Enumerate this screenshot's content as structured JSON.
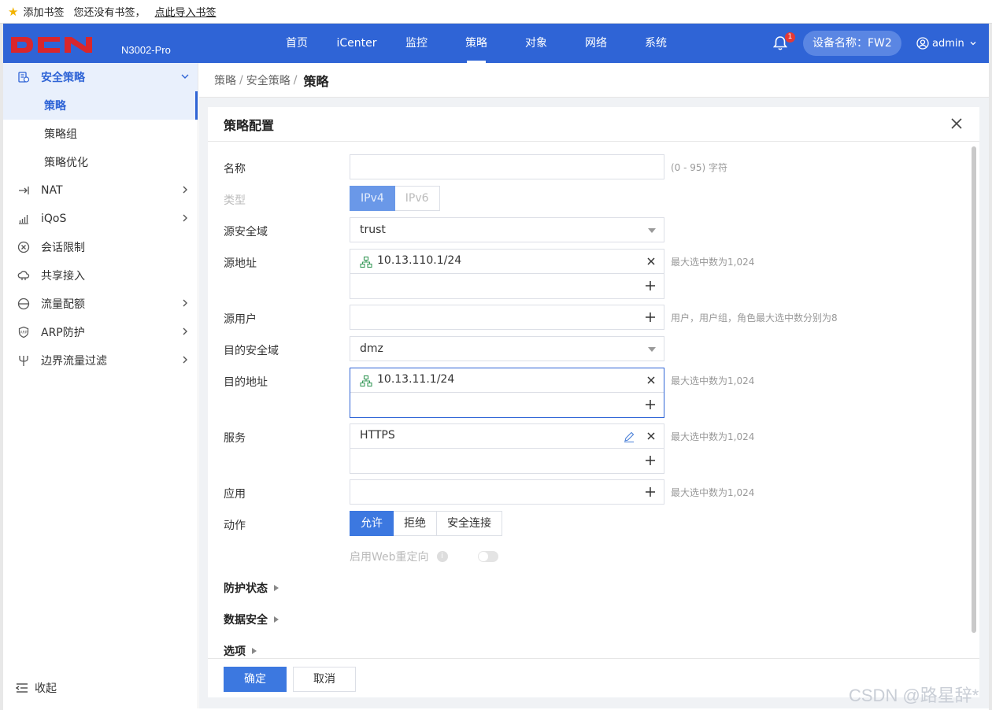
{
  "bookmarks_bar": {
    "add_bookmark": "添加书签",
    "no_bookmarks": "您还没有书签，",
    "import_link": "点此导入书签"
  },
  "header": {
    "model": "N3002-Pro",
    "nav": [
      "首页",
      "iCenter",
      "监控",
      "策略",
      "对象",
      "网络",
      "系统"
    ],
    "active_nav": "策略",
    "notification_count": "1",
    "device_name": "设备名称：FW2",
    "user": "admin",
    "brand_color": "#2f64d6"
  },
  "sidebar": {
    "group": {
      "label": "安全策略",
      "icon": "security-policy-icon"
    },
    "sub_items": [
      "策略",
      "策略组",
      "策略优化"
    ],
    "active_sub": "策略",
    "items": [
      {
        "label": "NAT",
        "icon": "nat-arrow-icon",
        "has_children": true
      },
      {
        "label": "iQoS",
        "icon": "bar-chart-icon",
        "has_children": true
      },
      {
        "label": "会话限制",
        "icon": "circle-x-icon",
        "has_children": false
      },
      {
        "label": "共享接入",
        "icon": "cloud-share-icon",
        "has_children": false
      },
      {
        "label": "流量配额",
        "icon": "quota-circle-icon",
        "has_children": true
      },
      {
        "label": "ARP防护",
        "icon": "arp-shield-icon",
        "has_children": true
      },
      {
        "label": "边界流量过滤",
        "icon": "trident-icon",
        "has_children": true
      }
    ],
    "collapse_label": "收起"
  },
  "breadcrumb": {
    "items": [
      "策略",
      "安全策略"
    ],
    "current": "策略"
  },
  "panel": {
    "title": "策略配置",
    "fields": {
      "name": {
        "label": "名称",
        "value": "",
        "hint": "(0 - 95) 字符"
      },
      "type": {
        "label": "类型",
        "options": [
          "IPv4",
          "IPv6"
        ],
        "selected": "IPv4"
      },
      "src_zone": {
        "label": "源安全域",
        "value": "trust"
      },
      "src_addr": {
        "label": "源地址",
        "values": [
          "10.13.110.1/24"
        ],
        "hint": "最大选中数为1,024"
      },
      "src_user": {
        "label": "源用户",
        "hint": "用户，用户组，角色最大选中数分别为8"
      },
      "dst_zone": {
        "label": "目的安全域",
        "value": "dmz"
      },
      "dst_addr": {
        "label": "目的地址",
        "values": [
          "10.13.11.1/24"
        ],
        "hint": "最大选中数为1,024"
      },
      "service": {
        "label": "服务",
        "values": [
          "HTTPS"
        ],
        "hint": "最大选中数为1,024"
      },
      "application": {
        "label": "应用",
        "hint": "最大选中数为1,024"
      },
      "action": {
        "label": "动作",
        "options": [
          "允许",
          "拒绝",
          "安全连接"
        ],
        "selected": "允许"
      },
      "web_redirect": {
        "label": "启用Web重定向",
        "enabled": false
      }
    },
    "sections": [
      "防护状态",
      "数据安全",
      "选项"
    ],
    "ok_label": "确定",
    "cancel_label": "取消"
  },
  "watermark": "CSDN @路星辞*"
}
